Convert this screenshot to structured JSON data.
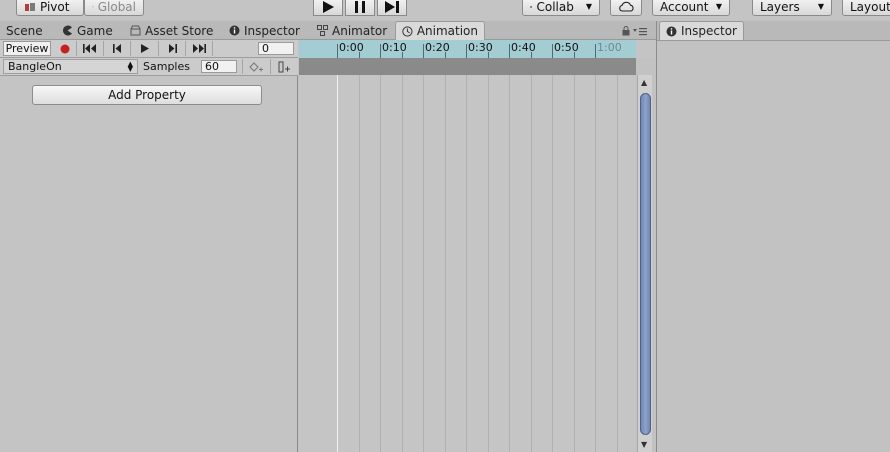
{
  "toolbar": {
    "pivot_label": "Pivot",
    "global_label": "Global",
    "collab_label": "Collab",
    "account_label": "Account",
    "layers_label": "Layers",
    "layout_label": "Layout"
  },
  "tabs": [
    {
      "label": "Scene",
      "icon": "scene-icon"
    },
    {
      "label": "Game",
      "icon": "pacman-icon"
    },
    {
      "label": "Asset Store",
      "icon": "store-icon"
    },
    {
      "label": "Inspector",
      "icon": "info-icon"
    },
    {
      "label": "Animator",
      "icon": "animator-icon"
    },
    {
      "label": "Animation",
      "icon": "clock-icon",
      "active": true
    }
  ],
  "animation": {
    "preview_label": "Preview",
    "frame_value": "0",
    "clip_name": "BangleOn",
    "samples_label": "Samples",
    "samples_value": "60",
    "add_property_label": "Add Property",
    "record_color": "#c82020"
  },
  "timeline": {
    "labels": [
      "0:00",
      "0:10",
      "0:20",
      "0:30",
      "0:40",
      "0:50",
      "1:00"
    ]
  },
  "inspector": {
    "title": "Inspector"
  }
}
